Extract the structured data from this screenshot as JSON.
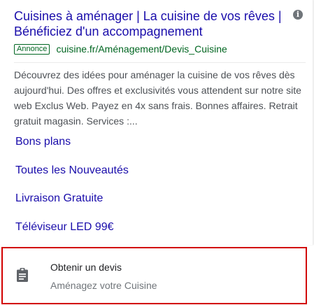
{
  "ad": {
    "title": "Cuisines à aménager | La cuisine de vos rêves | Bénéficiez d'un accompagnement",
    "badge": "Annonce",
    "display_url": "cuisine.fr/Aménagement/Devis_Cuisine",
    "description": "Découvrez des idées pour aménager la cuisine de vos rêves dès aujourd'hui. Des offres et exclusivités vous attendent sur notre site web Exclus Web. Payez en 4x sans frais. Bonnes affaires. Retrait gratuit magasin. Services :...",
    "info_icon": "info-icon",
    "info_glyph": "i"
  },
  "sitelinks": [
    {
      "label": "Bons plans"
    },
    {
      "label": "Toutes les Nouveautés"
    },
    {
      "label": "Livraison Gratuite"
    },
    {
      "label": "Téléviseur LED 99€"
    }
  ],
  "extension": {
    "icon": "clipboard-icon",
    "title": "Obtenir un devis",
    "subtitle": "Aménagez votre Cuisine"
  },
  "colors": {
    "link": "#1a0dab",
    "url_green": "#006621",
    "description_text": "#4d5156",
    "highlight_border": "#d20000"
  }
}
